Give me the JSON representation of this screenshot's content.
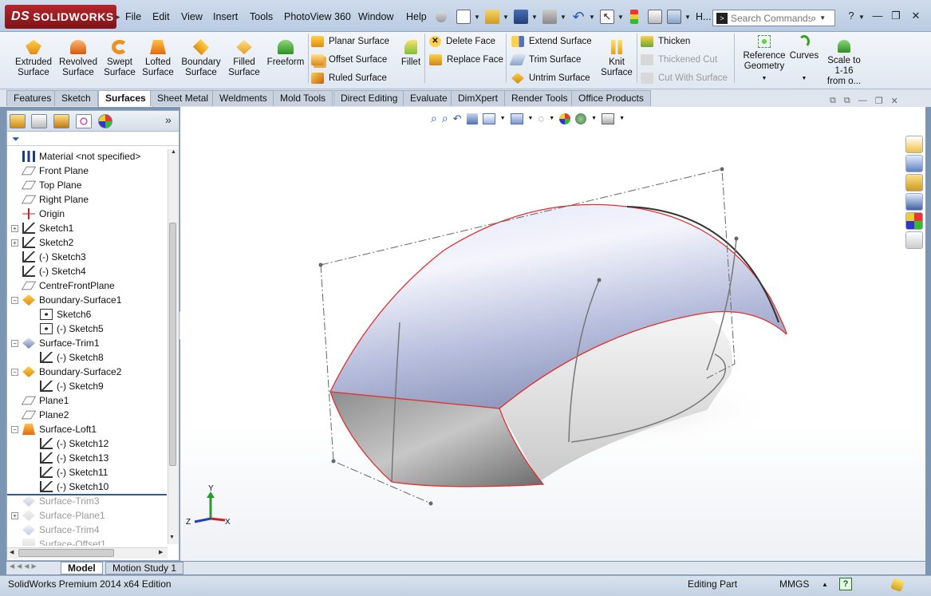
{
  "app": {
    "logo_text": "SOLIDWORKS",
    "logo_mark": "DS"
  },
  "menu": [
    "File",
    "Edit",
    "View",
    "Insert",
    "Tools",
    "PhotoView 360",
    "Window",
    "Help"
  ],
  "titlebar": {
    "overflow_label": "H...",
    "search_placeholder": "Search Commands",
    "help_icon": "?"
  },
  "ribbon": {
    "big_tools": [
      {
        "label": "Extruded\nSurface",
        "icon": "extruded-surface-icon"
      },
      {
        "label": "Revolved\nSurface",
        "icon": "revolved-surface-icon"
      },
      {
        "label": "Swept\nSurface",
        "icon": "swept-surface-icon"
      },
      {
        "label": "Lofted\nSurface",
        "icon": "lofted-surface-icon"
      },
      {
        "label": "Boundary\nSurface",
        "icon": "boundary-surface-icon"
      },
      {
        "label": "Filled\nSurface",
        "icon": "filled-surface-icon"
      },
      {
        "label": "Freeform",
        "icon": "freeform-icon"
      }
    ],
    "surface_group": [
      "Planar Surface",
      "Offset Surface",
      "Ruled Surface"
    ],
    "fillet": "Fillet",
    "face_group": [
      "Delete Face",
      "Replace Face"
    ],
    "extend_group": [
      "Extend Surface",
      "Trim Surface",
      "Untrim Surface"
    ],
    "knit": "Knit\nSurface",
    "thicken_group": [
      {
        "label": "Thicken",
        "disabled": false
      },
      {
        "label": "Thickened Cut",
        "disabled": true
      },
      {
        "label": "Cut With Surface",
        "disabled": true
      }
    ],
    "reference_geometry": "Reference\nGeometry",
    "curves": "Curves",
    "scale": "Scale to\n1-16\nfrom o..."
  },
  "tabs": [
    "Features",
    "Sketch",
    "Surfaces",
    "Sheet Metal",
    "Weldments",
    "Mold Tools",
    "Direct Editing",
    "Evaluate",
    "DimXpert",
    "Render Tools",
    "Office Products"
  ],
  "active_tab": "Surfaces",
  "feature_tree": [
    {
      "label": "Material <not specified>",
      "icon": "material-icon",
      "expander": "",
      "indent": 0,
      "suppressed": false
    },
    {
      "label": "Front Plane",
      "icon": "plane-icon",
      "expander": "",
      "indent": 0,
      "suppressed": false
    },
    {
      "label": "Top Plane",
      "icon": "plane-icon",
      "expander": "",
      "indent": 0,
      "suppressed": false
    },
    {
      "label": "Right Plane",
      "icon": "plane-icon",
      "expander": "",
      "indent": 0,
      "suppressed": false
    },
    {
      "label": "Origin",
      "icon": "origin-icon",
      "expander": "",
      "indent": 0,
      "suppressed": false
    },
    {
      "label": "Sketch1",
      "icon": "sketch-icon",
      "expander": "+",
      "indent": 0,
      "suppressed": false
    },
    {
      "label": "Sketch2",
      "icon": "sketch-icon",
      "expander": "+",
      "indent": 0,
      "suppressed": false
    },
    {
      "label": "(-) Sketch3",
      "icon": "sketch-icon",
      "expander": "",
      "indent": 0,
      "suppressed": false
    },
    {
      "label": "(-) Sketch4",
      "icon": "sketch-icon",
      "expander": "",
      "indent": 0,
      "suppressed": false
    },
    {
      "label": "CentreFrontPlane",
      "icon": "plane-icon",
      "expander": "",
      "indent": 0,
      "suppressed": false
    },
    {
      "label": "Boundary-Surface1",
      "icon": "boundary-surface-icon",
      "expander": "−",
      "indent": 0,
      "suppressed": false
    },
    {
      "label": "Sketch6",
      "icon": "sketch-3d-icon",
      "expander": "",
      "indent": 1,
      "suppressed": false
    },
    {
      "label": "(-) Sketch5",
      "icon": "sketch-3d-icon",
      "expander": "",
      "indent": 1,
      "suppressed": false
    },
    {
      "label": "Surface-Trim1",
      "icon": "trim-surface-icon",
      "expander": "−",
      "indent": 0,
      "suppressed": false
    },
    {
      "label": "(-) Sketch8",
      "icon": "sketch-icon",
      "expander": "",
      "indent": 1,
      "suppressed": false
    },
    {
      "label": "Boundary-Surface2",
      "icon": "boundary-surface-icon",
      "expander": "−",
      "indent": 0,
      "suppressed": false
    },
    {
      "label": "(-) Sketch9",
      "icon": "sketch-icon",
      "expander": "",
      "indent": 1,
      "suppressed": false
    },
    {
      "label": "Plane1",
      "icon": "plane-icon",
      "expander": "",
      "indent": 0,
      "suppressed": false
    },
    {
      "label": "Plane2",
      "icon": "plane-icon",
      "expander": "",
      "indent": 0,
      "suppressed": false
    },
    {
      "label": "Surface-Loft1",
      "icon": "lofted-surface-icon",
      "expander": "−",
      "indent": 0,
      "suppressed": false
    },
    {
      "label": "(-) Sketch12",
      "icon": "sketch-icon",
      "expander": "",
      "indent": 1,
      "suppressed": false
    },
    {
      "label": "(-) Sketch13",
      "icon": "sketch-icon",
      "expander": "",
      "indent": 1,
      "suppressed": false
    },
    {
      "label": "(-) Sketch11",
      "icon": "sketch-icon",
      "expander": "",
      "indent": 1,
      "suppressed": false
    },
    {
      "label": "(-) Sketch10",
      "icon": "sketch-icon",
      "expander": "",
      "indent": 1,
      "suppressed": false
    },
    {
      "label": "Surface-Trim3",
      "icon": "trim-surface-icon",
      "expander": "",
      "indent": 0,
      "suppressed": true
    },
    {
      "label": "Surface-Plane1",
      "icon": "planar-surface-icon",
      "expander": "+",
      "indent": 0,
      "suppressed": true
    },
    {
      "label": "Surface-Trim4",
      "icon": "trim-surface-icon",
      "expander": "",
      "indent": 0,
      "suppressed": true
    },
    {
      "label": "Surface-Offset1",
      "icon": "offset-surface-icon",
      "expander": "",
      "indent": 0,
      "suppressed": true
    }
  ],
  "axes": {
    "x": "X",
    "y": "Y",
    "z": "Z"
  },
  "bottom_tabs": [
    "Model",
    "Motion Study 1"
  ],
  "active_bottom_tab": "Model",
  "status": {
    "edition": "SolidWorks Premium 2014 x64 Edition",
    "mode": "Editing Part",
    "units": "MMGS",
    "units_arrow": "▲",
    "help": "?"
  },
  "colors": {
    "accent": "#2c59a8",
    "logo": "#b4262b",
    "surface": "#c9cfe6",
    "edge": "#e03030"
  }
}
